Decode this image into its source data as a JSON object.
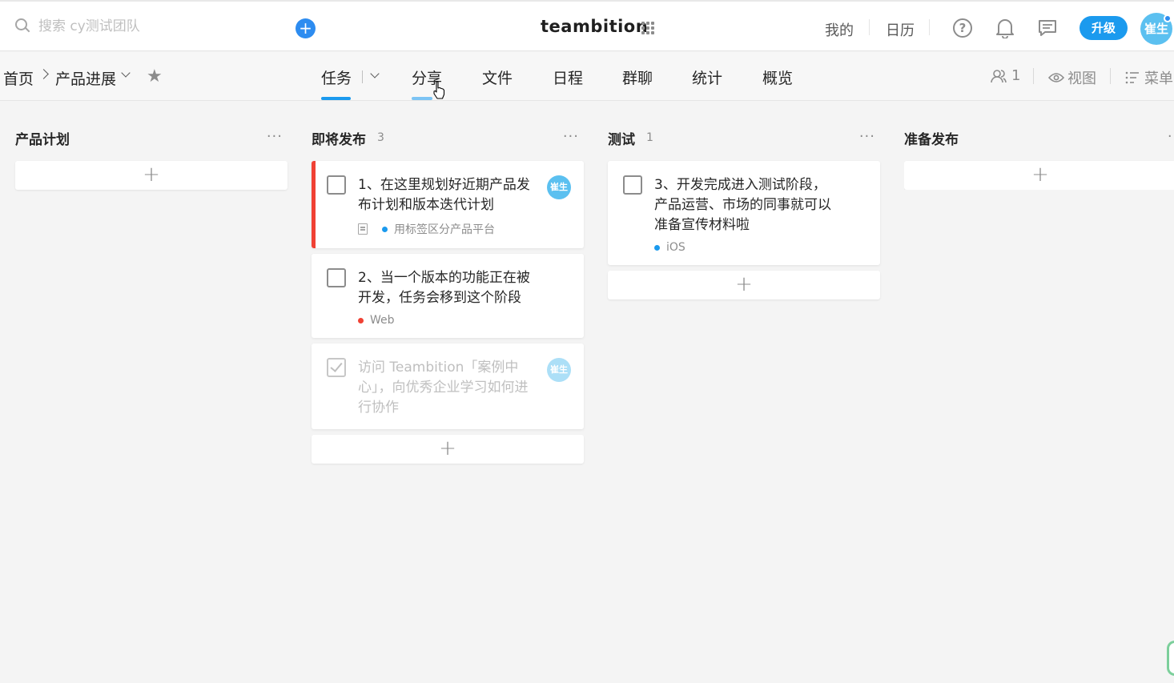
{
  "topbar": {
    "search_placeholder": "搜索 cy测试团队",
    "add_label": "+",
    "logo": "teambition",
    "links": [
      "我的",
      "日历"
    ],
    "help_label": "?",
    "upgrade_label": "升级",
    "avatar_text": "崔生"
  },
  "project": {
    "breadcrumb": [
      "首页",
      "产品进展"
    ],
    "tabs": [
      {
        "label": "任务",
        "active": true
      },
      {
        "label": "分享"
      },
      {
        "label": "文件"
      },
      {
        "label": "日程"
      },
      {
        "label": "群聊"
      },
      {
        "label": "统计"
      },
      {
        "label": "概览"
      }
    ],
    "members_count": "1",
    "view_label": "视图",
    "menu_label": "菜单"
  },
  "columns": [
    {
      "title": "产品计划",
      "count": "",
      "more": "···"
    },
    {
      "title": "即将发布",
      "count": "3",
      "more": "···"
    },
    {
      "title": "测试",
      "count": "1",
      "more": "···"
    },
    {
      "title": "准备发布",
      "count": "",
      "more": "···"
    }
  ],
  "cards": {
    "c1": {
      "title": "1、在这里规划好近期产品发布计划和版本迭代计划",
      "tag": "用标签区分产品平台",
      "tag_color": "#1b9aee",
      "avatar": "崔生"
    },
    "c2": {
      "title": "2、当一个版本的功能正在被开发，任务会移到这个阶段",
      "tag": "Web",
      "tag_color": "#f04134"
    },
    "c3": {
      "title": "访问 Teambition「案例中心」，向优秀企业学习如何进行协作",
      "avatar": "崔生"
    },
    "c4": {
      "title": "3、开发完成进入测试阶段，产品运营、市场的同事就可以准备宣传材料啦",
      "tag": "iOS",
      "tag_color": "#1b9aee"
    }
  },
  "add_card_label": "+",
  "colors": {
    "accent": "#1b9aee",
    "urgent": "#f04134",
    "background": "#f4f4f4"
  }
}
